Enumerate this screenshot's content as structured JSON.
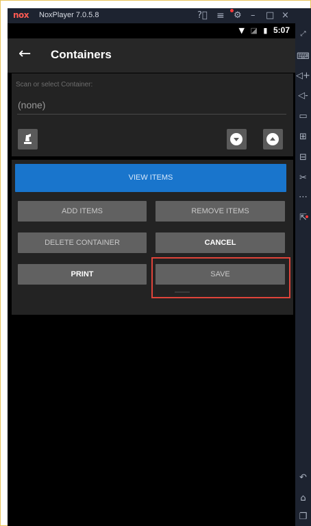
{
  "window": {
    "logo": "nox",
    "title": "NoxPlayer 7.0.5.8",
    "controls": [
      "help-icon",
      "menu-icon",
      "settings-icon",
      "minimize-icon",
      "maximize-icon",
      "close-icon",
      "collapse-icon"
    ]
  },
  "status_bar": {
    "time": "5:07",
    "icons": [
      "wifi-icon",
      "signal-icon",
      "battery-icon"
    ]
  },
  "app_bar": {
    "title": "Containers"
  },
  "scan_panel": {
    "label": "Scan or select Container:",
    "value": "(none)"
  },
  "buttons": {
    "view_items": "VIEW ITEMS",
    "add_items": "ADD ITEMS",
    "remove_items": "REMOVE ITEMS",
    "delete_container": "DELETE CONTAINER",
    "cancel": "CANCEL",
    "print": "PRINT",
    "save": "SAVE"
  },
  "toolbar": {
    "items": [
      "fullscreen-icon",
      "keyboard-icon",
      "volume-up-icon",
      "volume-down-icon",
      "screen-icon",
      "add-apk-icon",
      "clean-icon",
      "scissors-icon",
      "more-icon",
      "multi-window-icon",
      "back-icon",
      "home-icon",
      "recent-apps-icon"
    ]
  },
  "colors": {
    "accent_blue": "#1975cc",
    "highlight_red": "#e0443a",
    "button_gray": "#616161",
    "frame_bg": "#1d2330"
  }
}
